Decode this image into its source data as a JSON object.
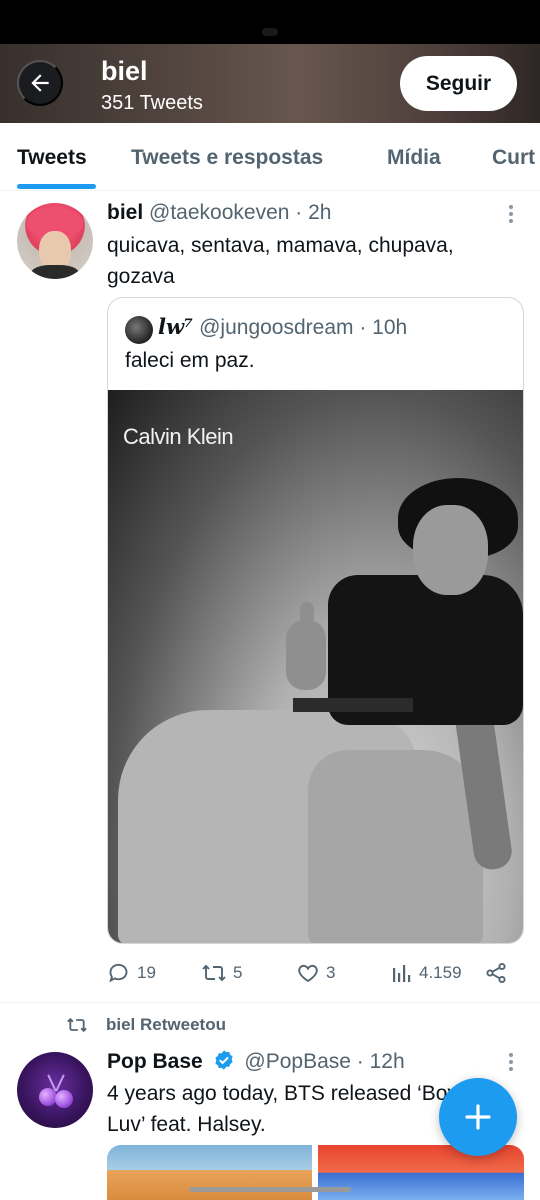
{
  "header": {
    "title": "biel",
    "subtitle": "351 Tweets",
    "follow_label": "Seguir"
  },
  "tabs": [
    {
      "label": "Tweets",
      "active": true
    },
    {
      "label": "Tweets e respostas",
      "active": false
    },
    {
      "label": "Mídia",
      "active": false
    },
    {
      "label": "Curt",
      "active": false
    }
  ],
  "tweet1": {
    "name": "biel",
    "handle_time": "@taekookeven · 2h",
    "text": "quicava, sentava, mamava, chupava, gozava",
    "quote": {
      "name": "lw⁷",
      "handle_time": "@jungoosdream · 10h",
      "text": "faleci em paz.",
      "media_brand": "Calvin Klein"
    },
    "actions": {
      "replies": "19",
      "retweets": "5",
      "likes": "3",
      "views": "4.159"
    }
  },
  "tweet2": {
    "retweet_label": "biel Retweetou",
    "name": "Pop Base",
    "handle_time": "@PopBase · 12h",
    "text": "4 years ago today, BTS released ‘Boy With Luv’ feat. Halsey."
  },
  "colors": {
    "accent": "#1d9bf0",
    "text_primary": "#0f1419",
    "text_secondary": "#536471",
    "border": "#eff3f4"
  },
  "icons": [
    "back-arrow-icon",
    "more-icon",
    "reply-icon",
    "retweet-icon",
    "like-icon",
    "views-icon",
    "share-icon",
    "verified-icon",
    "plus-icon"
  ]
}
